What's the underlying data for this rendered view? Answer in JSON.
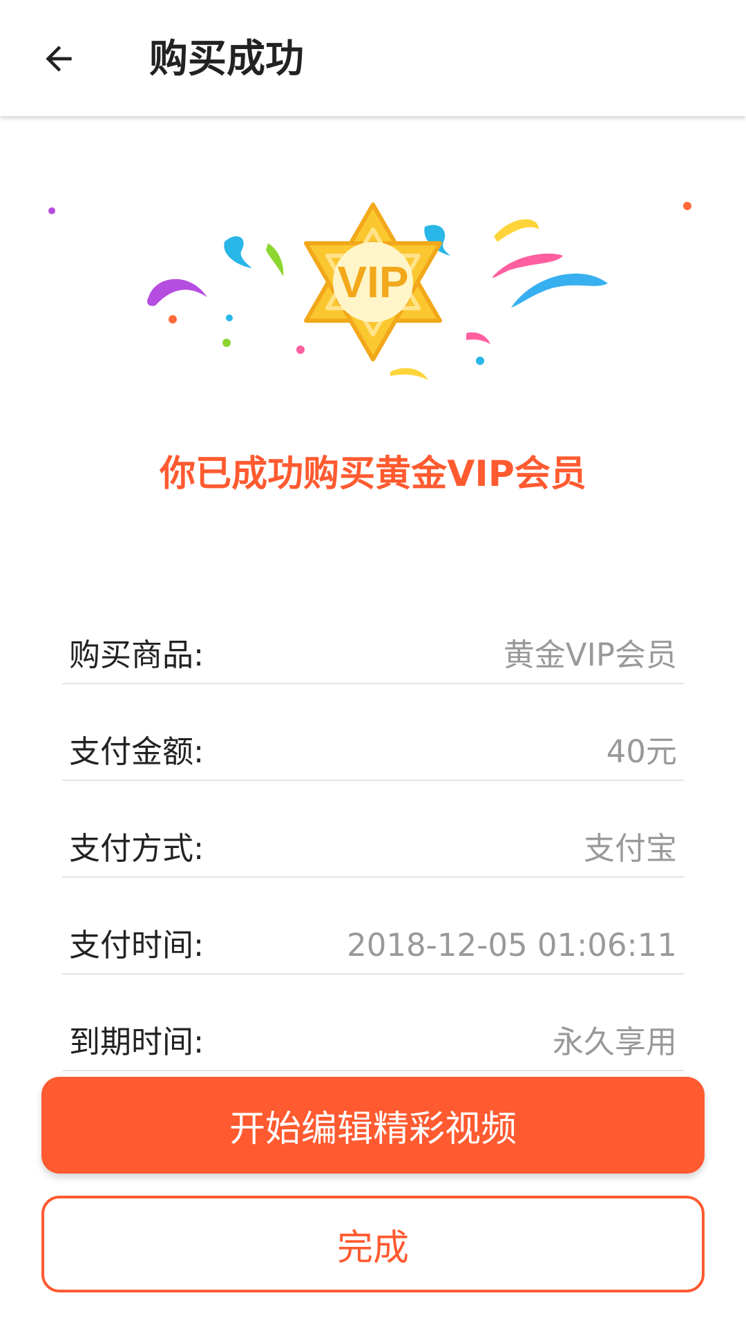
{
  "header": {
    "title": "购买成功",
    "back_icon": "arrow-back-icon"
  },
  "hero": {
    "badge_text": "VIP",
    "badge_icon": "vip-star-badge-icon",
    "colors": {
      "gold": "#fbc72f",
      "gold_dark": "#f2a81a",
      "purple": "#b54de0",
      "teal": "#29b6e8",
      "green": "#8bd630",
      "pink": "#ff5fa0",
      "orange": "#ff6a3a",
      "yellow": "#ffd43a",
      "blue": "#38b0f0"
    }
  },
  "success_message": "你已成功购买黄金VIP会员",
  "details": [
    {
      "label": "购买商品:",
      "value": "黄金VIP会员"
    },
    {
      "label": "支付金额:",
      "value": "40元"
    },
    {
      "label": "支付方式:",
      "value": "支付宝"
    },
    {
      "label": "支付时间:",
      "value": "2018-12-05 01:06:11"
    },
    {
      "label": "到期时间:",
      "value": "永久享用"
    }
  ],
  "actions": {
    "primary_label": "开始编辑精彩视频",
    "secondary_label": "完成"
  },
  "theme": {
    "accent": "#ff5a30",
    "label_text": "#222222",
    "value_text": "#999999",
    "divider": "#e2e2e2"
  }
}
